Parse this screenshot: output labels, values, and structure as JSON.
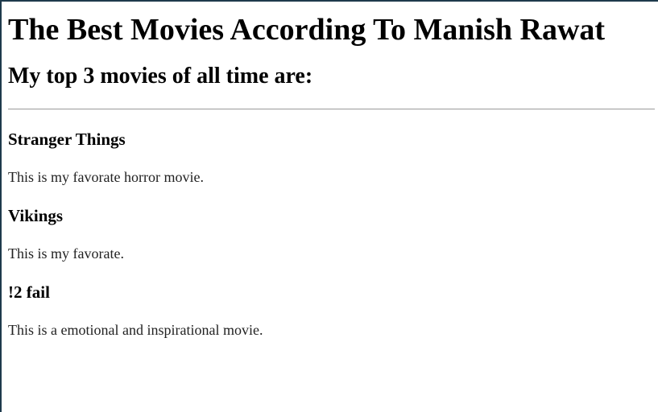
{
  "page": {
    "heading": "The Best Movies According To Manish Rawat",
    "subheading": "My top 3 movies of all time are:"
  },
  "movies": [
    {
      "title": "Stranger Things",
      "description": "This is my favorate horror movie."
    },
    {
      "title": "Vikings",
      "description": "This is my favorate."
    },
    {
      "title": "!2 fail",
      "description": "This is a emotional and inspirational movie."
    }
  ]
}
